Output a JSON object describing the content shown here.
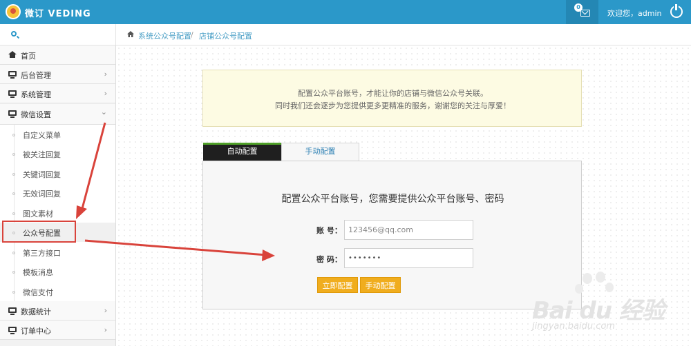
{
  "header": {
    "brand": "微订 VEDING",
    "message_count": "0",
    "welcome": "欢迎您，admin"
  },
  "breadcrumb": {
    "item1": "系统公众号配置",
    "separator": "/",
    "item2": "店铺公众号配置"
  },
  "sidebar": {
    "items": [
      {
        "label": "首页",
        "icon": "home-icon"
      },
      {
        "label": "后台管理",
        "icon": "monitor-icon",
        "chevron": "›"
      },
      {
        "label": "系统管理",
        "icon": "monitor-icon",
        "chevron": "›"
      },
      {
        "label": "微信设置",
        "icon": "monitor-icon",
        "chevron": "⌄"
      }
    ],
    "sub_items": [
      {
        "label": "自定义菜单"
      },
      {
        "label": "被关注回复"
      },
      {
        "label": "关键词回复"
      },
      {
        "label": "无效词回复"
      },
      {
        "label": "图文素材"
      },
      {
        "label": "公众号配置"
      },
      {
        "label": "第三方接口"
      },
      {
        "label": "模板消息"
      },
      {
        "label": "微信支付"
      }
    ],
    "bottom_items": [
      {
        "label": "数据统计",
        "icon": "monitor-icon",
        "chevron": "›"
      },
      {
        "label": "订单中心",
        "icon": "monitor-icon",
        "chevron": "›"
      }
    ]
  },
  "notice": {
    "line1": "配置公众平台账号，才能让你的店铺与微信公众号关联。",
    "line2": "同时我们还会逐步为您提供更多更精准的服务，谢谢您的关注与厚爱！"
  },
  "tabs": {
    "auto": "自动配置",
    "manual": "手动配置"
  },
  "form": {
    "title": "配置公众平台账号，您需要提供公众平台账号、密码",
    "account_label": "账 号：",
    "account_value": "123456@qq.com",
    "password_label": "密 码：",
    "password_value": "•••••••",
    "submit_label": "立即配置",
    "manual_label": "手动配置"
  },
  "watermark": {
    "brand": "Bai du 经验",
    "url": "jingyan.baidu.com"
  },
  "colors": {
    "topbar": "#2b98c9",
    "button": "#f0ad1e",
    "tab_active": "#1f1f1f",
    "annotation": "#d9433b"
  }
}
